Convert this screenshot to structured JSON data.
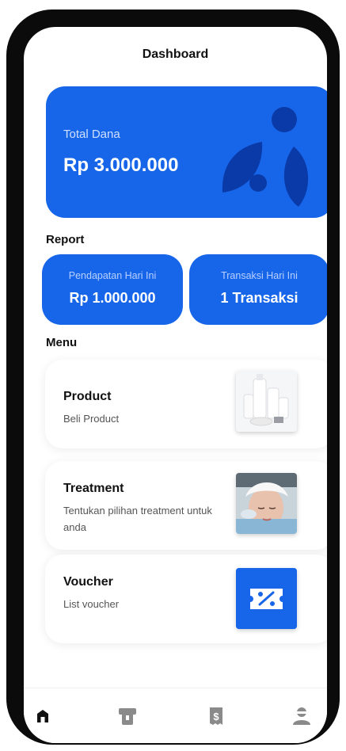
{
  "header": {
    "title": "Dashboard"
  },
  "total": {
    "label": "Total Dana",
    "value": "Rp 3.000.000",
    "decoration": "leaf-dots-graphic"
  },
  "report": {
    "heading": "Report",
    "cards": [
      {
        "label": "Pendapatan Hari Ini",
        "value": "Rp 1.000.000"
      },
      {
        "label": "Transaksi Hari Ini",
        "value": "1 Transaksi"
      }
    ]
  },
  "menu": {
    "heading": "Menu",
    "items": [
      {
        "title": "Product",
        "desc": "Beli Product",
        "image": "product-bottles-image"
      },
      {
        "title": "Treatment",
        "desc": "Tentukan pilihan treatment untuk anda",
        "image": "facial-treatment-image"
      },
      {
        "title": "Voucher",
        "desc": "List voucher",
        "image": "voucher-ticket-icon"
      }
    ]
  },
  "nav": {
    "items": [
      {
        "icon": "home-icon",
        "active": true
      },
      {
        "icon": "atm-card-icon",
        "active": false
      },
      {
        "icon": "receipt-dollar-icon",
        "active": false
      },
      {
        "icon": "profile-icon",
        "active": false
      }
    ]
  },
  "colors": {
    "primary": "#1766ea",
    "deco_dark": "#0a3aa8",
    "nav_active": "#111111",
    "nav_inactive": "#8a8a8a"
  }
}
